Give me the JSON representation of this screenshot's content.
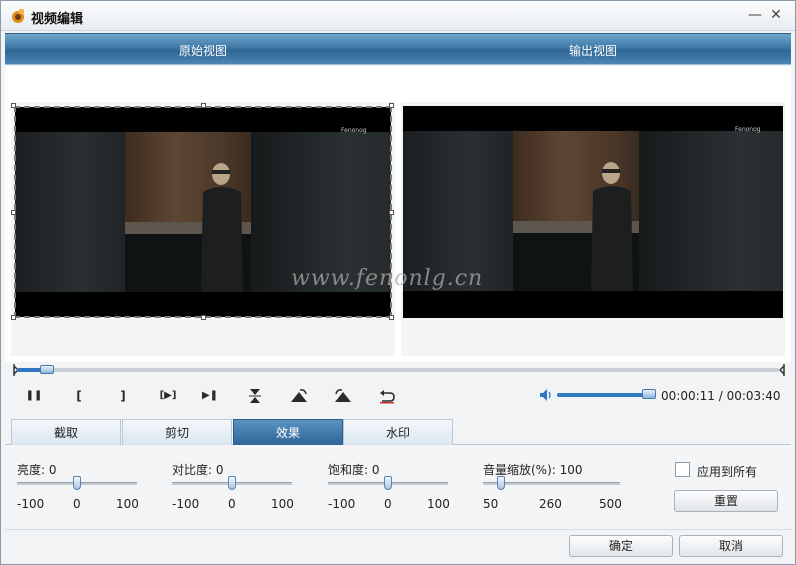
{
  "window": {
    "title": "视频编辑",
    "minimize_glyph": "—",
    "close_glyph": "✕"
  },
  "views": {
    "original_label": "原始视图",
    "output_label": "输出视图"
  },
  "video": {
    "brand_logo": "Fenonog",
    "site_watermark": "www.fenonlg.cn"
  },
  "playback": {
    "progress_fraction": 0.04,
    "current_time": "00:00:11",
    "separator": "/",
    "total_time": "00:03:40",
    "volume_fraction": 0.95,
    "buttons": {
      "pause": "❚❚",
      "mark_in": "[",
      "mark_out": "]",
      "step": "[▶]",
      "next": "▶❚"
    }
  },
  "tabs": [
    {
      "label": "截取",
      "active": false
    },
    {
      "label": "剪切",
      "active": false
    },
    {
      "label": "效果",
      "active": true
    },
    {
      "label": "水印",
      "active": false
    }
  ],
  "effects": {
    "brightness": {
      "label": "亮度",
      "value": "0",
      "min": "-100",
      "mid": "0",
      "max": "100"
    },
    "contrast": {
      "label": "对比度",
      "value": "0",
      "min": "-100",
      "mid": "0",
      "max": "100"
    },
    "saturation": {
      "label": "饱和度",
      "value": "0",
      "min": "-100",
      "mid": "0",
      "max": "100"
    },
    "volume": {
      "label": "音量缩放(%)",
      "value": "100",
      "min": "50",
      "mid": "260",
      "max": "500"
    },
    "apply_all_label": "应用到所有",
    "reset_label": "重置"
  },
  "footer": {
    "ok_label": "确定",
    "cancel_label": "取消"
  },
  "colors": {
    "accent": "#2f77c0",
    "header_blue": "#3f79a8",
    "active_tab": "#2e6596"
  }
}
